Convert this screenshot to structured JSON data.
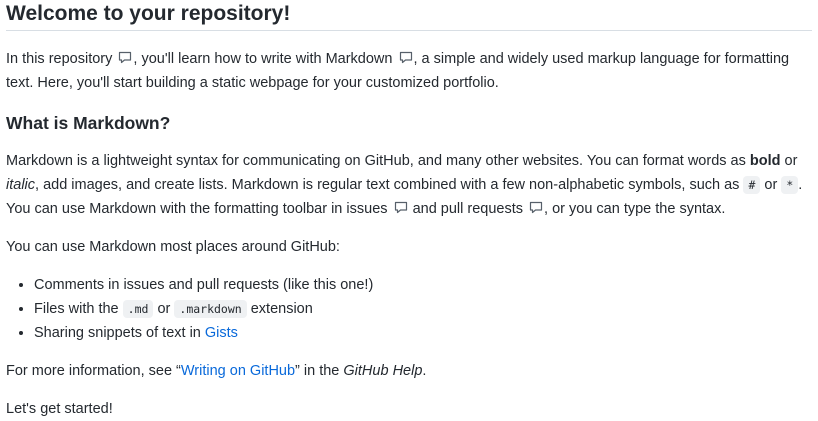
{
  "heading": "Welcome to your repository!",
  "intro": {
    "t1": "In this repository ",
    "t2": ", you'll learn how to write with Markdown ",
    "t3": ", a simple and widely used markup language for formatting text. Here, you'll start building a static webpage for your customized portfolio."
  },
  "section_title": "What is Markdown?",
  "md_para": {
    "t1": "Markdown is a lightweight syntax for communicating on GitHub, and many other websites. You can format words as ",
    "bold": "bold",
    "t2": " or ",
    "italic": "italic",
    "t3": ", add images, and create lists. Markdown is regular text combined with a few non-alphabetic symbols, such as ",
    "code_hash": "#",
    "t4": " or ",
    "code_star": "*",
    "t5": ". You can use Markdown with the formatting toolbar in issues ",
    "t6": " and pull requests ",
    "t7": ", or you can type the syntax."
  },
  "uses_intro": "You can use Markdown most places around GitHub:",
  "list": {
    "item1": "Comments in issues and pull requests (like this one!)",
    "item2_a": "Files with the ",
    "item2_code1": ".md",
    "item2_b": " or ",
    "item2_code2": ".markdown",
    "item2_c": " extension",
    "item3_a": "Sharing snippets of text in ",
    "item3_link": "Gists"
  },
  "more_info": {
    "t1": "For more information, see “",
    "link": "Writing on GitHub",
    "t2": "” in the ",
    "italic": "GitHub Help",
    "t3": "."
  },
  "closing": "Let's get started!",
  "icons": {
    "comment": "comment-bubble-icon"
  },
  "colors": {
    "text": "#24292f",
    "link": "#0969da",
    "code_bg": "#eff1f3",
    "divider": "#d8dee4"
  }
}
